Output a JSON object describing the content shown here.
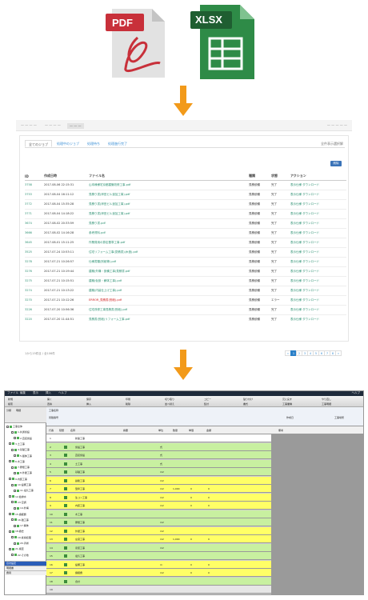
{
  "pdf_icon": {
    "label": "PDF",
    "color": "#c8303a"
  },
  "xlsx_icon": {
    "label": "XLSX",
    "color": "#2e8b47"
  },
  "arrow_color": "#f29a1a",
  "list_screen": {
    "tabs": [
      "全てのジョブ",
      "処理中のジョブ",
      "処理待ち",
      "処理進行完了"
    ],
    "right_label": "全件表示選択解",
    "delete_label": "削除",
    "columns": [
      "ID",
      "作成日時",
      "ファイル名",
      "種類",
      "状態",
      "アクション"
    ],
    "rows": [
      {
        "id": "3758",
        "date": "2017-08-06 22:15:31",
        "file": "山本様様宅京都建築改修工事.pdf",
        "type": "見積依頼",
        "status": "完了",
        "action": "表示仕様  ダウンロード"
      },
      {
        "id": "3753",
        "date": "2017-08-04 16:11:12",
        "file": "見積り書(岸田ビル追加工事).pdf",
        "type": "見積依頼",
        "status": "完了",
        "action": "表示仕様  ダウンロード"
      },
      {
        "id": "3772",
        "date": "2017-08-04 15:35:28",
        "file": "見積り書(岸田ビル追加工事).pdf",
        "type": "見積依頼",
        "status": "完了",
        "action": "表示仕様  ダウンロード"
      },
      {
        "id": "3771",
        "date": "2017-08-04 14:18:22",
        "file": "見積り書(岸田ビル追加工事).pdf",
        "type": "見積依頼",
        "status": "完了",
        "action": "表示仕様  ダウンロード"
      },
      {
        "id": "3674",
        "date": "2017-08-02 20:33:59",
        "file": "見積り書.pdf",
        "type": "見積依頼",
        "status": "完了",
        "action": "表示仕様  ダウンロード"
      },
      {
        "id": "3666",
        "date": "2017-08-02 14:16:28",
        "file": "参考資料.pdf",
        "type": "見積依頼",
        "status": "完了",
        "action": "表示仕様  ダウンロード"
      },
      {
        "id": "3645",
        "date": "2017-08-01 15:11:25",
        "file": "作業費用の算定基準工事.pdf",
        "type": "見積依頼",
        "status": "完了",
        "action": "表示仕様  ダウンロード"
      },
      {
        "id": "3525",
        "date": "2017-07-24 10:53:11",
        "file": "住宅リフォーム工事(見積書)(木造).pdf",
        "type": "見積依頼",
        "status": "完了",
        "action": "表示仕様  ダウンロード"
      },
      {
        "id": "3278",
        "date": "2017-07-21 10:26:57",
        "file": "仕様書類(別紙等).pdf",
        "type": "見積依頼",
        "status": "完了",
        "action": "表示仕様  ダウンロード"
      },
      {
        "id": "3276",
        "date": "2017-07-21 10:19:44",
        "file": "建築(外構・設備工事)見積書.pdf",
        "type": "見積依頼",
        "status": "完了",
        "action": "表示仕様  ダウンロード"
      },
      {
        "id": "3275",
        "date": "2017-07-21 10:15:51",
        "file": "建築(仮設・解体工事).pdf",
        "type": "見積依頼",
        "status": "完了",
        "action": "表示仕様  ダウンロード"
      },
      {
        "id": "3274",
        "date": "2017-07-21 10:13:22",
        "file": "建築(内装仕上げ工事).pdf",
        "type": "見積依頼",
        "status": "完了",
        "action": "表示仕様  ダウンロード"
      },
      {
        "id": "3270",
        "date": "2017-07-21 10:12:26",
        "file": "ERROR_見積書(別紙).pdf",
        "type": "見積依頼",
        "status": "エラー",
        "action": "表示仕様  ダウンロード",
        "error": true
      },
      {
        "id": "3226",
        "date": "2017-07-20 10:56:36",
        "file": "住宅改修工事見積書(別紙).pdf",
        "type": "見積依頼",
        "status": "完了",
        "action": "表示仕様  ダウンロード"
      },
      {
        "id": "3220",
        "date": "2017-07-20 11:44:51",
        "file": "見積書(別紙)リフォーム工事.pdf",
        "type": "見積依頼",
        "status": "完了",
        "action": "表示仕様  ダウンロード"
      }
    ],
    "pagination_info": "1から15件目 / 全106件",
    "pages": [
      "«",
      "1",
      "2",
      "3",
      "4",
      "5",
      "6",
      "7",
      "8",
      "»"
    ]
  },
  "sheet_screen": {
    "title_menu": [
      "ファイル",
      "編集",
      "表示",
      "挿入",
      "ヘルプ"
    ],
    "title_right": "ヘルプ",
    "toolbar_items": [
      "新規",
      "開く",
      "保存",
      "印刷",
      "切り取り",
      "コピー",
      "貼り付け",
      "元に戻す",
      "やり直し",
      "検索",
      "置換",
      "挿入",
      "削除",
      "並べ替え",
      "集計",
      "書式",
      "工事業種",
      "工事明細"
    ],
    "left_tabs": [
      "分類",
      "明細"
    ],
    "left_footer": [
      "目次設定",
      "明細書",
      "費用"
    ],
    "tree": [
      "工事全体",
      "1.共通仮設",
      "2.直接仮設",
      "3.土工事",
      "4.基礎工事",
      "5.躯体工事",
      "6.木工事",
      "7.屋根工事",
      "8.外壁工事",
      "9.内装工事",
      "10.設備工事",
      "11.電気工事",
      "12.給排水",
      "13.空調",
      "14.外構",
      "15.諸経費",
      "16.雑工事",
      "17.解体",
      "18.撤去",
      "19.産廃処理",
      "20.清掃",
      "21.検査",
      "22.その他"
    ],
    "header_meta": [
      "工事名称",
      "見積番号",
      "作成日",
      "工事場所"
    ],
    "columns": [
      "行番",
      "階層",
      "名称",
      "摘要",
      "単位",
      "数量",
      "単価",
      "金額",
      "備考"
    ],
    "rows": [
      {
        "name": "新築工事",
        "desc": "",
        "unit": "",
        "qty": "",
        "price": "",
        "amount": "",
        "color": "#ffffff"
      },
      {
        "name": "仮設工事",
        "desc": "",
        "unit": "式",
        "qty": "",
        "price": "",
        "amount": "",
        "color": "#c8f0a0"
      },
      {
        "name": "直接仮設",
        "desc": "",
        "unit": "式",
        "qty": "",
        "price": "",
        "amount": "",
        "color": "#c8f0a0"
      },
      {
        "name": "土工事",
        "desc": "",
        "unit": "式",
        "qty": "",
        "price": "",
        "amount": "",
        "color": "#c8f0a0"
      },
      {
        "name": "基礎工事",
        "desc": "",
        "unit": "m2",
        "qty": "",
        "price": "",
        "amount": "",
        "color": "#c8f0a0"
      },
      {
        "name": "鉄筋工事",
        "desc": "",
        "unit": "m2",
        "qty": "",
        "price": "",
        "amount": "",
        "color": "#ffff66"
      },
      {
        "name": "型枠工事",
        "desc": "",
        "unit": "m2",
        "qty": "1,000",
        "price": "0",
        "amount": "0",
        "color": "#ffff66"
      },
      {
        "name": "生コン工事",
        "desc": "",
        "unit": "m2",
        "qty": "",
        "price": "0",
        "amount": "0",
        "color": "#ffff66"
      },
      {
        "name": "内装工事",
        "desc": "",
        "unit": "m2",
        "qty": "",
        "price": "0",
        "amount": "0",
        "color": "#ffff66"
      },
      {
        "name": "木工事",
        "desc": "",
        "unit": "",
        "qty": "",
        "price": "",
        "amount": "",
        "color": "#c8f0a0"
      },
      {
        "name": "屋根工事",
        "desc": "",
        "unit": "m2",
        "qty": "",
        "price": "",
        "amount": "",
        "color": "#c8f0a0"
      },
      {
        "name": "外壁工事",
        "desc": "",
        "unit": "m2",
        "qty": "",
        "price": "",
        "amount": "",
        "color": "#ffff66"
      },
      {
        "name": "左官工事",
        "desc": "",
        "unit": "m2",
        "qty": "1,000",
        "price": "0",
        "amount": "0",
        "color": "#ffff66"
      },
      {
        "name": "塗装工事",
        "desc": "",
        "unit": "m2",
        "qty": "",
        "price": "",
        "amount": "",
        "color": "#c8f0a0"
      },
      {
        "name": "電気工事",
        "desc": "",
        "unit": "",
        "qty": "",
        "price": "",
        "amount": "",
        "color": "#c8f0a0"
      },
      {
        "name": "設備工事",
        "desc": "",
        "unit": "m",
        "qty": "",
        "price": "0",
        "amount": "0",
        "color": "#ffff66"
      },
      {
        "name": "諸経費",
        "desc": "",
        "unit": "m2",
        "qty": "",
        "price": "0",
        "amount": "0",
        "color": "#ffff66"
      },
      {
        "name": "合計",
        "desc": "",
        "unit": "",
        "qty": "",
        "price": "",
        "amount": "",
        "color": "#c8f0a0"
      },
      {
        "name": "",
        "desc": "",
        "unit": "",
        "qty": "",
        "price": "",
        "amount": "",
        "color": "#e6e6e6"
      }
    ]
  }
}
